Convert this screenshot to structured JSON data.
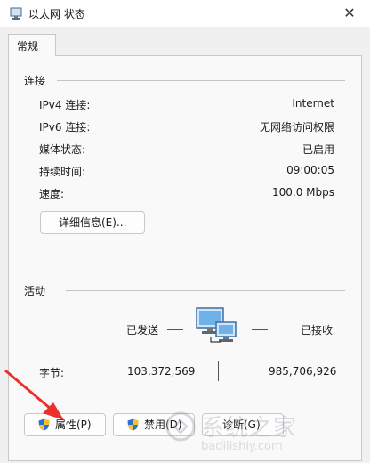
{
  "window": {
    "title": "以太网 状态",
    "close_glyph": "✕"
  },
  "tabs": [
    {
      "label": "常规",
      "selected": true
    }
  ],
  "connection": {
    "heading": "连接",
    "rows": [
      {
        "label": "IPv4 连接:",
        "value": "Internet"
      },
      {
        "label": "IPv6 连接:",
        "value": "无网络访问权限"
      },
      {
        "label": "媒体状态:",
        "value": "已启用"
      },
      {
        "label": "持续时间:",
        "value": "09:00:05"
      },
      {
        "label": "速度:",
        "value": "100.0 Mbps"
      }
    ],
    "details_button": "详细信息(E)..."
  },
  "activity": {
    "heading": "活动",
    "sent_label": "已发送",
    "received_label": "已接收",
    "bytes_label": "字节:",
    "bytes_sent": "103,372,569",
    "bytes_received": "985,706,926"
  },
  "buttons": {
    "properties": "属性(P)",
    "disable": "禁用(D)",
    "diagnose": "诊断(G)"
  },
  "watermark": {
    "text": "系统之家",
    "sub": "badilishiy.com"
  },
  "colors": {
    "arrow": "#e8322b",
    "shield_blue": "#2f6fd0",
    "shield_yellow": "#f3c22c"
  }
}
